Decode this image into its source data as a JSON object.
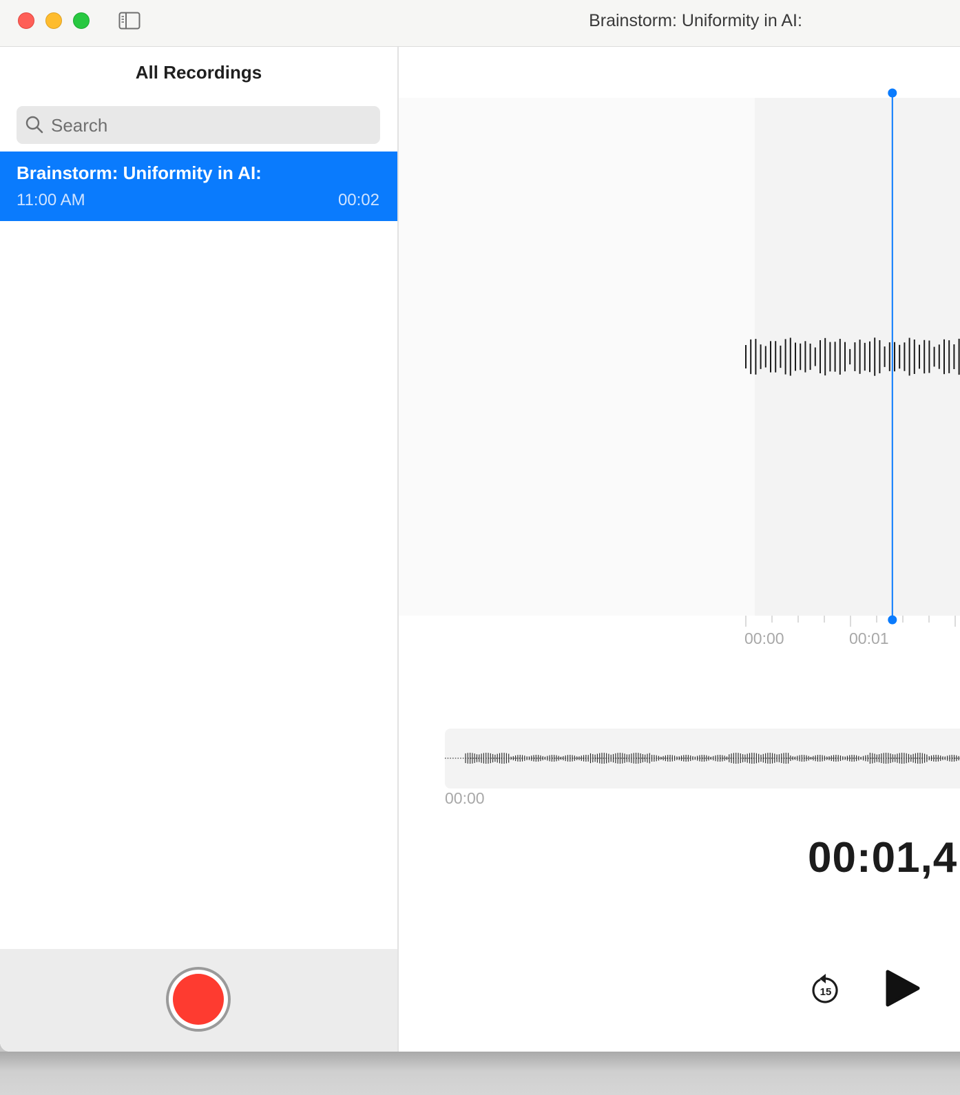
{
  "window": {
    "title": "Brainstorm: Uniformity in AI:"
  },
  "sidebar": {
    "heading": "All Recordings",
    "search": {
      "placeholder": "Search",
      "value": ""
    },
    "recordings": [
      {
        "title": "Brainstorm: Uniformity in AI:",
        "time": "11:00 AM",
        "duration": "00:02",
        "selected": true
      }
    ]
  },
  "player": {
    "timeline_ticks": [
      "00:00",
      "00:01"
    ],
    "overview_start": "00:00",
    "current_time": "00:01,4",
    "playhead_seconds": 1.4,
    "skip_back_seconds": "15"
  },
  "colors": {
    "accent": "#0a7bfd",
    "record": "#fe3b30",
    "close": "#fe5f57",
    "minimize": "#febc2e",
    "zoom": "#28c840"
  },
  "icons": [
    "sidebar-toggle-icon",
    "search-icon",
    "record-icon",
    "skip-back-15-icon",
    "play-icon"
  ]
}
